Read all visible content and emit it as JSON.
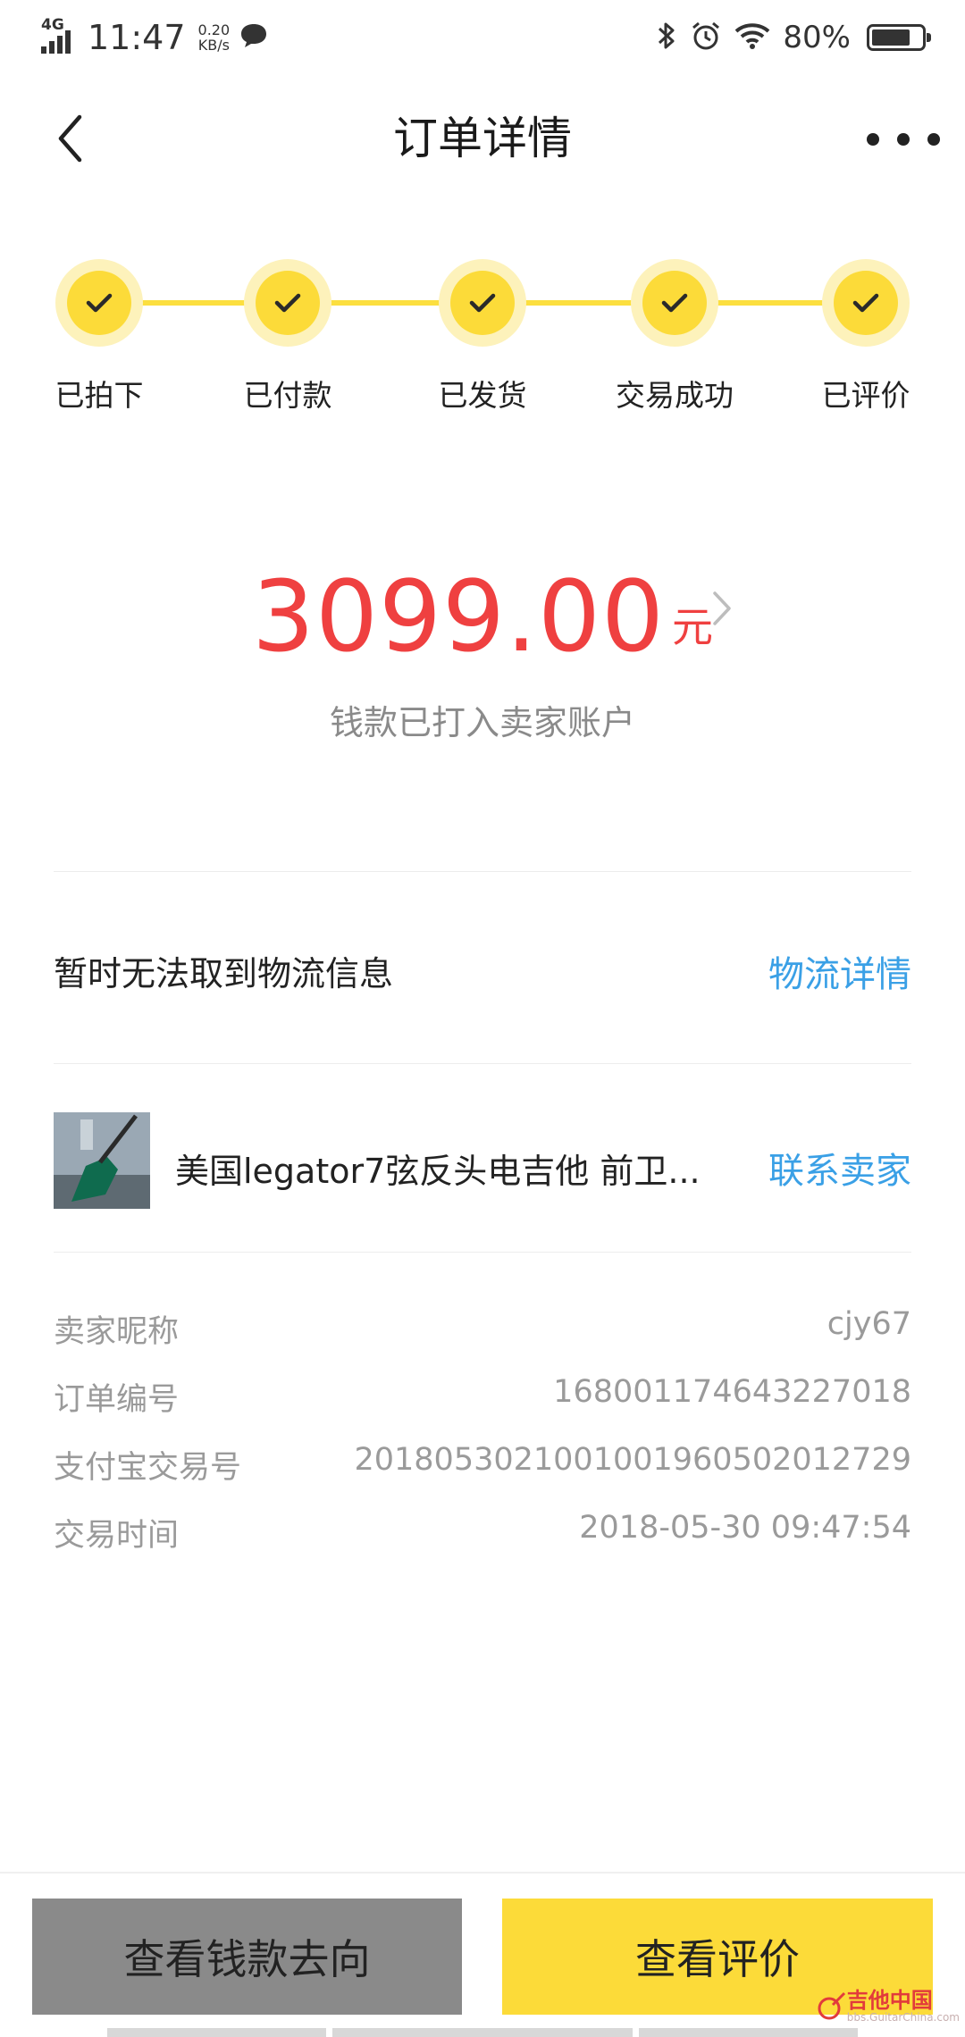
{
  "status_bar": {
    "network": "4G",
    "time": "11:47",
    "speed_value": "0.20",
    "speed_unit": "KB/s",
    "battery": "80%",
    "battery_level": 0.8
  },
  "nav": {
    "title": "订单详情"
  },
  "steps": [
    {
      "label": "已拍下",
      "done": true
    },
    {
      "label": "已付款",
      "done": true
    },
    {
      "label": "已发货",
      "done": true
    },
    {
      "label": "交易成功",
      "done": true
    },
    {
      "label": "已评价",
      "done": true
    }
  ],
  "amount": {
    "value": "3099.00",
    "unit": "元",
    "status": "钱款已打入卖家账户"
  },
  "logistics": {
    "message": "暂时无法取到物流信息",
    "link": "物流详情"
  },
  "product": {
    "title": "美国legator7弦反头电吉他 前卫...",
    "contact": "联系卖家"
  },
  "details": [
    {
      "label": "卖家昵称",
      "value": "cjy67"
    },
    {
      "label": "订单编号",
      "value": "168001174643227018"
    },
    {
      "label": "支付宝交易号",
      "value": "2018053021001001960502012729"
    },
    {
      "label": "交易时间",
      "value": "2018-05-30 09:47:54"
    }
  ],
  "actions": {
    "view_money": "查看钱款去向",
    "view_review": "查看评价"
  },
  "watermark": {
    "text": "吉他中国",
    "sub": "bbs.GuitarChina.com"
  },
  "colors": {
    "accent_yellow": "#fcdb39",
    "amount_red": "#ef4040",
    "link_blue": "#3aa0e6",
    "button_grey": "#8a8a8a"
  }
}
